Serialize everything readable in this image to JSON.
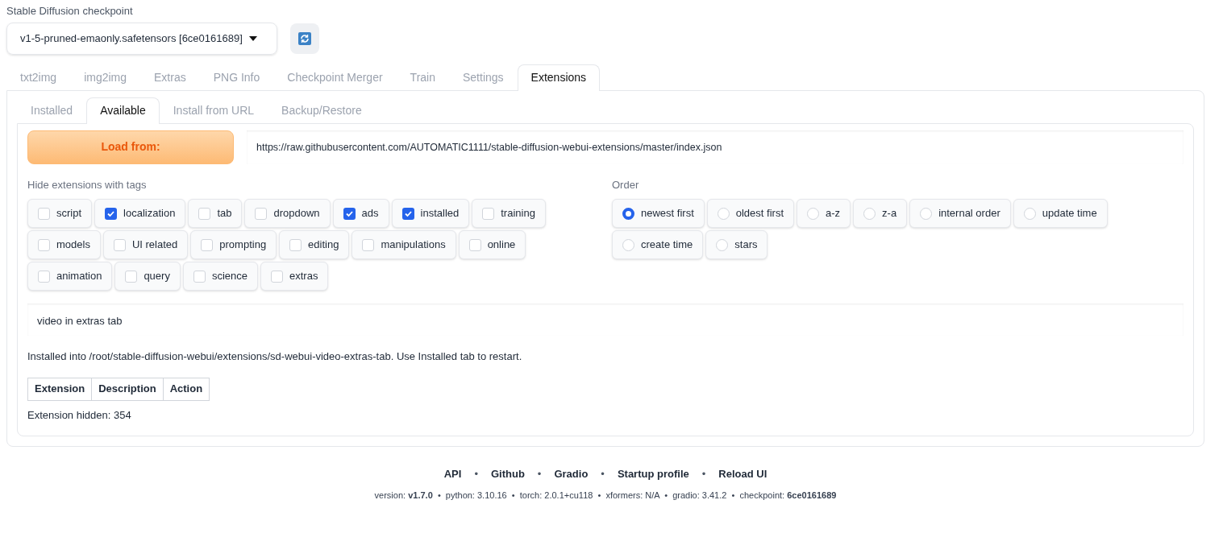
{
  "checkpoint": {
    "label": "Stable Diffusion checkpoint",
    "value": "v1-5-pruned-emaonly.safetensors [6ce0161689]"
  },
  "tabs": [
    {
      "label": "txt2img",
      "selected": false
    },
    {
      "label": "img2img",
      "selected": false
    },
    {
      "label": "Extras",
      "selected": false
    },
    {
      "label": "PNG Info",
      "selected": false
    },
    {
      "label": "Checkpoint Merger",
      "selected": false
    },
    {
      "label": "Train",
      "selected": false
    },
    {
      "label": "Settings",
      "selected": false
    },
    {
      "label": "Extensions",
      "selected": true
    }
  ],
  "subtabs": [
    {
      "label": "Installed",
      "selected": false
    },
    {
      "label": "Available",
      "selected": true
    },
    {
      "label": "Install from URL",
      "selected": false
    },
    {
      "label": "Backup/Restore",
      "selected": false
    }
  ],
  "load_button": "Load from:",
  "url": "https://raw.githubusercontent.com/AUTOMATIC1111/stable-diffusion-webui-extensions/master/index.json",
  "hide_tags": {
    "label": "Hide extensions with tags",
    "items": [
      {
        "label": "script",
        "checked": false
      },
      {
        "label": "localization",
        "checked": true
      },
      {
        "label": "tab",
        "checked": false
      },
      {
        "label": "dropdown",
        "checked": false
      },
      {
        "label": "ads",
        "checked": true
      },
      {
        "label": "installed",
        "checked": true
      },
      {
        "label": "training",
        "checked": false
      },
      {
        "label": "models",
        "checked": false
      },
      {
        "label": "UI related",
        "checked": false
      },
      {
        "label": "prompting",
        "checked": false
      },
      {
        "label": "editing",
        "checked": false
      },
      {
        "label": "manipulations",
        "checked": false
      },
      {
        "label": "online",
        "checked": false
      },
      {
        "label": "animation",
        "checked": false
      },
      {
        "label": "query",
        "checked": false
      },
      {
        "label": "science",
        "checked": false
      },
      {
        "label": "extras",
        "checked": false
      }
    ]
  },
  "order": {
    "label": "Order",
    "items": [
      {
        "label": "newest first",
        "selected": true
      },
      {
        "label": "oldest first",
        "selected": false
      },
      {
        "label": "a-z",
        "selected": false
      },
      {
        "label": "z-a",
        "selected": false
      },
      {
        "label": "internal order",
        "selected": false
      },
      {
        "label": "update time",
        "selected": false
      },
      {
        "label": "create time",
        "selected": false
      },
      {
        "label": "stars",
        "selected": false
      }
    ]
  },
  "search": "video in extras tab",
  "install_message": "Installed into /root/stable-diffusion-webui/extensions/sd-webui-video-extras-tab. Use Installed tab to restart.",
  "table": {
    "columns": [
      "Extension",
      "Description",
      "Action"
    ]
  },
  "hidden_count": "Extension hidden: 354",
  "footer": {
    "items": [
      {
        "kind": "link",
        "text": "API"
      },
      {
        "kind": "separator",
        "text": "•"
      },
      {
        "kind": "link",
        "text": "Github"
      },
      {
        "kind": "separator",
        "text": "•"
      },
      {
        "kind": "link",
        "text": "Gradio"
      },
      {
        "kind": "separator",
        "text": "•"
      },
      {
        "kind": "link",
        "text": "Startup profile"
      },
      {
        "kind": "separator",
        "text": "•"
      },
      {
        "kind": "link",
        "text": "Reload UI"
      }
    ],
    "versions": "version: **v1.7.0**  •  python: 3.10.16  •  torch: 2.0.1+cu118  •  xformers: N/A  •  gradio: 3.41.2  •  checkpoint: **6ce0161689**"
  }
}
